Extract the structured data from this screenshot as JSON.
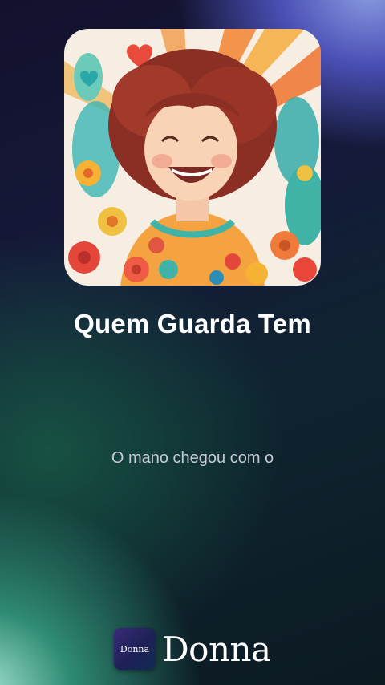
{
  "song": {
    "title": "Quem Guarda Tem",
    "lyric_line": "O mano chegou com o"
  },
  "artwork": {
    "description_icon": "album-art-image"
  },
  "brand": {
    "badge_text": "Donna",
    "wordmark": "Donna"
  },
  "colors": {
    "title": "#ffffff",
    "lyric": "#c7cbd6"
  }
}
